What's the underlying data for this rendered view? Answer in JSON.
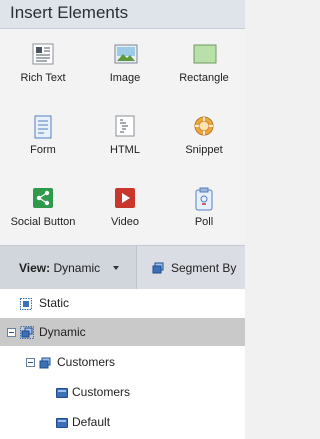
{
  "header": {
    "title": "Insert Elements"
  },
  "elements": [
    {
      "label": "Rich Text",
      "icon": "rich-text-icon"
    },
    {
      "label": "Image",
      "icon": "image-icon"
    },
    {
      "label": "Rectangle",
      "icon": "rectangle-icon"
    },
    {
      "label": "Form",
      "icon": "form-icon"
    },
    {
      "label": "HTML",
      "icon": "html-icon"
    },
    {
      "label": "Snippet",
      "icon": "snippet-icon"
    },
    {
      "label": "Social Button",
      "icon": "share-icon"
    },
    {
      "label": "Video",
      "icon": "video-play-icon"
    },
    {
      "label": "Poll",
      "icon": "poll-icon"
    }
  ],
  "toolbar": {
    "view_prefix": "View:",
    "view_value": "Dynamic",
    "segment_label": "Segment By"
  },
  "tree": [
    {
      "label": "Static",
      "selected": false
    },
    {
      "label": "Dynamic",
      "selected": true
    },
    {
      "label": "Customers",
      "selected": false
    },
    {
      "label": "Customers",
      "selected": false
    },
    {
      "label": "Default",
      "selected": false
    }
  ],
  "colors": {
    "header_bg": "#dfe3ea",
    "selected_row": "#c9c9c9",
    "node_blue": "#3b6fb6",
    "social_green": "#2f9a4b",
    "video_red": "#c9372c"
  }
}
